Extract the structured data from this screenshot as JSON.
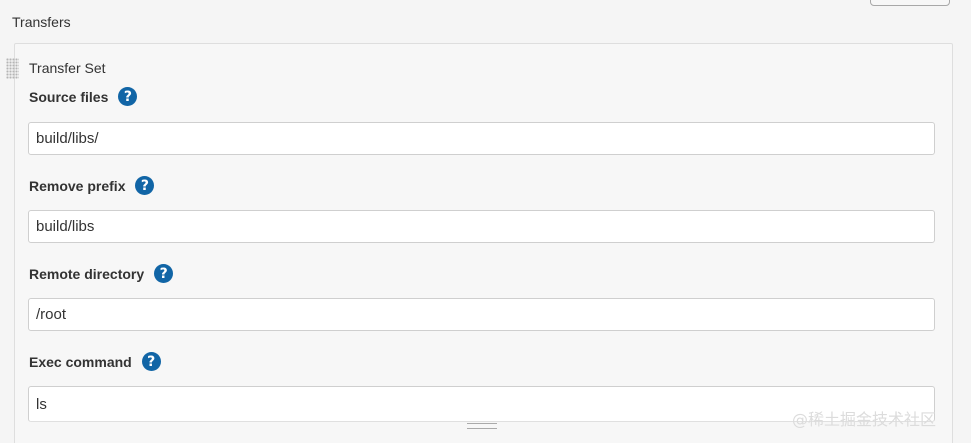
{
  "section": {
    "title": "Transfers"
  },
  "transfer_set": {
    "title": "Transfer Set",
    "fields": [
      {
        "label": "Source files",
        "value": "build/libs/",
        "help_icon": "question-circle-icon"
      },
      {
        "label": "Remove prefix",
        "value": "build/libs",
        "help_icon": "question-circle-icon"
      },
      {
        "label": "Remote directory",
        "value": "/root",
        "help_icon": "question-circle-icon"
      },
      {
        "label": "Exec command",
        "value": "ls",
        "help_icon": "question-circle-icon"
      }
    ]
  },
  "help_glyph": "?",
  "watermark": "@稀土掘金技术社区",
  "colors": {
    "help_icon_bg": "#1165a6",
    "panel_bg": "#f7f7f7",
    "input_border": "#cfcfcf"
  }
}
